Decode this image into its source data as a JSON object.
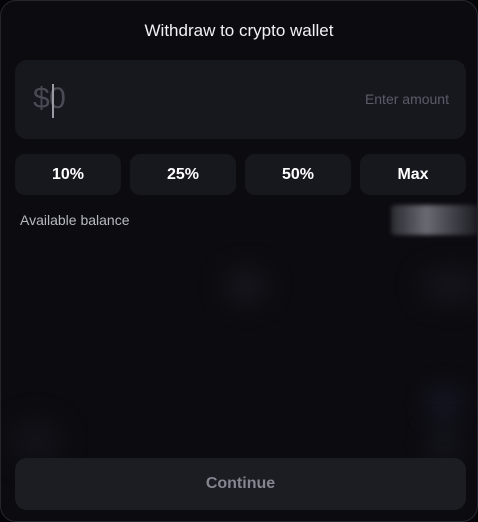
{
  "modal": {
    "title": "Withdraw to crypto wallet"
  },
  "amount": {
    "value": "$0",
    "placeholder": "Enter amount"
  },
  "percent_buttons": [
    {
      "label": "10%"
    },
    {
      "label": "25%"
    },
    {
      "label": "50%"
    },
    {
      "label": "Max"
    }
  ],
  "balance": {
    "label": "Available balance"
  },
  "actions": {
    "continue_label": "Continue"
  },
  "colors": {
    "background": "#0b0b10",
    "surface": "#17171e",
    "text_primary": "#ffffff",
    "text_muted": "#5c5c68"
  }
}
